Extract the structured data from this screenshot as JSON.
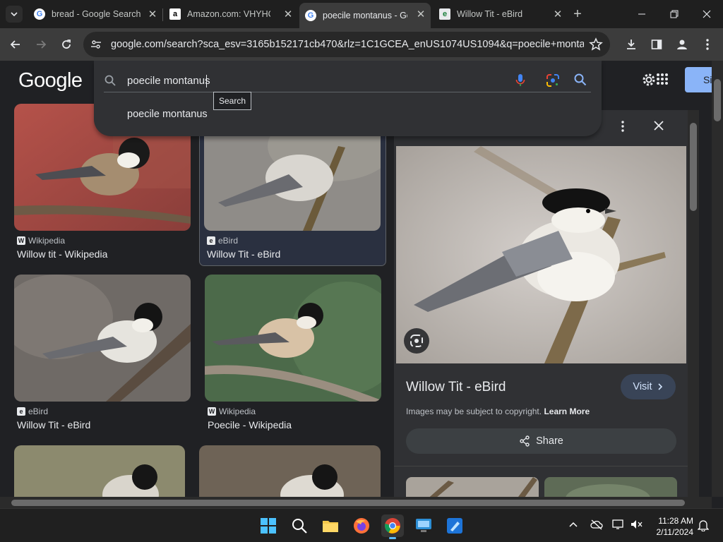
{
  "browser": {
    "tabs": [
      {
        "title": "bread - Google Search",
        "favicon": "google-icon",
        "active": false
      },
      {
        "title": "Amazon.com: VHYHCY",
        "favicon": "amazon-icon",
        "active": false
      },
      {
        "title": "poecile montanus - Go",
        "favicon": "google-icon",
        "active": true
      },
      {
        "title": "Willow Tit - eBird",
        "favicon": "ebird-icon",
        "active": false
      }
    ],
    "url": "google.com/search?sca_esv=3165b152171cb470&rlz=1C1GCEA_enUS1074US1094&q=poecile+montanus..."
  },
  "google": {
    "logo": "Google",
    "signin_label": "Si",
    "search": {
      "query": "poecile montanus",
      "suggestion": "poecile montanus",
      "tooltip": "Search"
    }
  },
  "results": [
    {
      "source": "Wikipedia",
      "source_badge": "W",
      "caption": "Willow tit - Wikipedia"
    },
    {
      "source": "eBird",
      "source_badge": "e",
      "caption": "Willow Tit - eBird"
    },
    {
      "source": "eBird",
      "source_badge": "e",
      "caption": "Willow Tit - eBird"
    },
    {
      "source": "Wikipedia",
      "source_badge": "W",
      "caption": "Poecile - Wikipedia"
    }
  ],
  "preview": {
    "title": "Willow Tit - eBird",
    "visit_label": "Visit",
    "copyright_text": "Images may be subject to copyright.",
    "learn_more": "Learn More",
    "share_label": "Share"
  },
  "taskbar": {
    "time": "11:28 AM",
    "date": "2/11/2024"
  },
  "colors": {
    "page_bg": "#202124",
    "panel_bg": "#303134",
    "accent_blue": "#8ab4f8",
    "taskbar_indicator": "#5cbcff"
  }
}
